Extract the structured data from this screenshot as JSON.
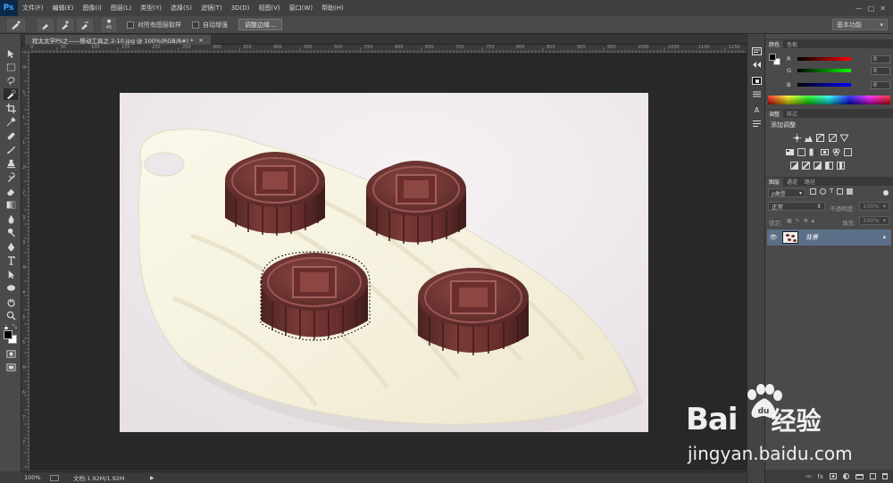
{
  "app": {
    "logo": "Ps"
  },
  "menu": [
    "文件(F)",
    "编辑(E)",
    "图像(I)",
    "图层(L)",
    "类型(Y)",
    "选择(S)",
    "滤镜(T)",
    "3D(D)",
    "视图(V)",
    "窗口(W)",
    "帮助(H)"
  ],
  "window_controls": [
    "—",
    "□",
    "✕"
  ],
  "options_bar": {
    "brush_size": "45",
    "sample_all_layers": "对所有图层取样",
    "auto_enhance": "自动增强",
    "refine_edge": "调整边缘...",
    "workspace": "基本功能"
  },
  "document": {
    "tab_title": "程太太学PS之——移动工具之 2-10.jpg @ 100%(RGB/8#) *",
    "close": "×",
    "zoom": "100%",
    "doc_size": "文档:1.92M/1.92M"
  },
  "ruler_top": [
    "0",
    "50",
    "100",
    "150",
    "200",
    "250",
    "300",
    "350",
    "400",
    "450",
    "500",
    "550",
    "600",
    "650",
    "700",
    "750",
    "800",
    "850",
    "900",
    "950",
    "1000",
    "1050",
    "1100",
    "1150"
  ],
  "ruler_left": [
    "0",
    "5",
    "1",
    "1",
    "2",
    "2",
    "3",
    "3",
    "4",
    "4",
    "5",
    "5",
    "6",
    "6",
    "7",
    "7"
  ],
  "color_panel": {
    "tabs": [
      "颜色",
      "色板"
    ],
    "channels": [
      {
        "label": "R",
        "value": "0"
      },
      {
        "label": "G",
        "value": "0"
      },
      {
        "label": "B",
        "value": "0"
      }
    ]
  },
  "adjust_panel": {
    "tabs": [
      "调整",
      "样式"
    ],
    "title": "添加调整"
  },
  "layers_panel": {
    "tabs": [
      "图层",
      "通道",
      "路径"
    ],
    "filter": "ρ类型",
    "blend_mode": "正常",
    "opacity_label": "不透明度:",
    "opacity_value": "100%",
    "lock_label": "锁定:",
    "fill_label": "填充:",
    "fill_value": "100%",
    "layer_name": "背景"
  },
  "footer_icons": [
    "ထ",
    "fx"
  ],
  "watermark": {
    "brand_a": "Bai",
    "brand_b": "du",
    "brand_cn": "经验",
    "url": "jingyan.baidu.com"
  },
  "colors": {
    "accent": "#5c6f88",
    "bg": "#282828",
    "panel": "#4a4a4a"
  }
}
